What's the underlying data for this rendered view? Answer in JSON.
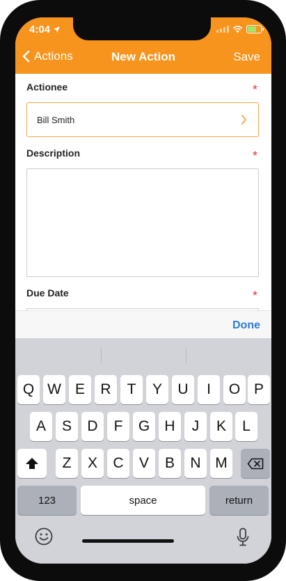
{
  "status": {
    "time": "4:04"
  },
  "nav": {
    "back_label": "Actions",
    "title": "New Action",
    "save_label": "Save"
  },
  "form": {
    "actionee": {
      "label": "Actionee",
      "value": "Bill Smith",
      "required_mark": "*"
    },
    "description": {
      "label": "Description",
      "value": "",
      "required_mark": "*"
    },
    "due_date": {
      "label": "Due Date",
      "required_mark": "*"
    }
  },
  "accessory": {
    "done_label": "Done"
  },
  "keyboard": {
    "row1": [
      "Q",
      "W",
      "E",
      "R",
      "T",
      "Y",
      "U",
      "I",
      "O",
      "P"
    ],
    "row2": [
      "A",
      "S",
      "D",
      "F",
      "G",
      "H",
      "J",
      "K",
      "L"
    ],
    "row3": [
      "Z",
      "X",
      "C",
      "V",
      "B",
      "N",
      "M"
    ],
    "numbers_label": "123",
    "space_label": "space",
    "return_label": "return"
  },
  "colors": {
    "accent": "#f7941d",
    "done_blue": "#2a7bd8",
    "required_red": "#d9363e"
  },
  "icons": [
    "location-arrow-icon",
    "signal-icon",
    "wifi-icon",
    "battery-icon",
    "chevron-left-icon",
    "chevron-right-icon",
    "shift-icon",
    "backspace-icon",
    "emoji-icon",
    "microphone-icon"
  ]
}
